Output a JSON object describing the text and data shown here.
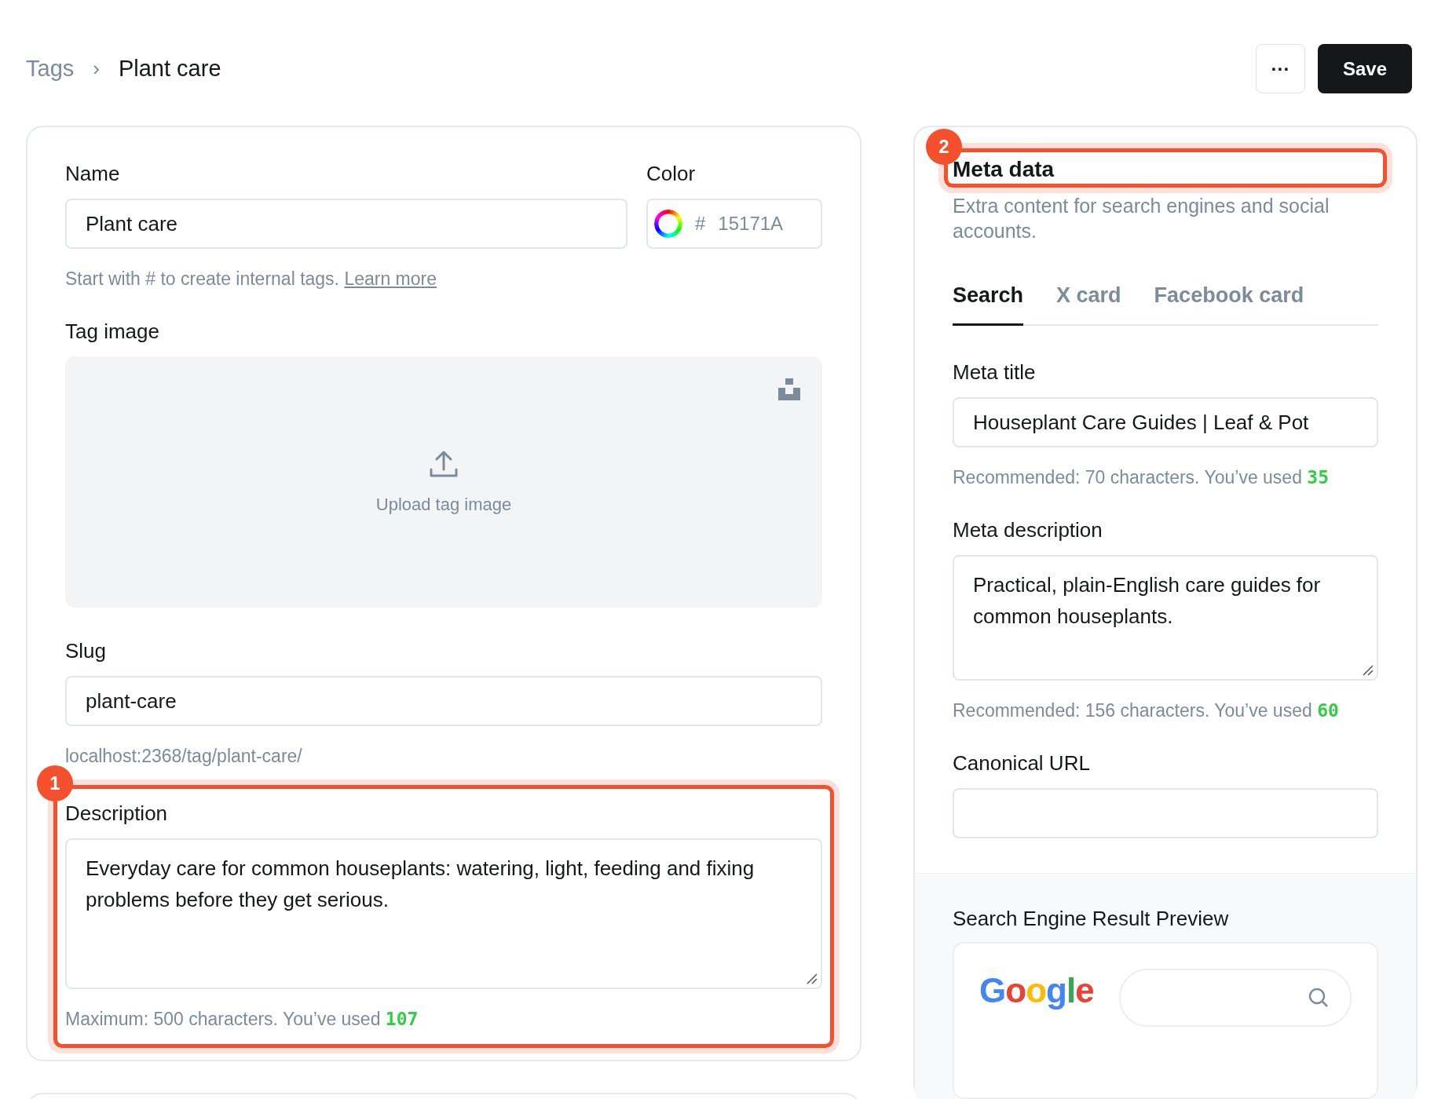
{
  "breadcrumb": {
    "parent": "Tags",
    "separator": "›",
    "current": "Plant care"
  },
  "header_actions": {
    "more": "···",
    "save": "Save"
  },
  "tag_form": {
    "name": {
      "label": "Name",
      "value": "Plant care"
    },
    "color": {
      "label": "Color",
      "hash": "#",
      "value": "15171A"
    },
    "name_hint": {
      "text": "Start with # to create internal tags.",
      "link": "Learn more"
    },
    "image": {
      "label": "Tag image",
      "upload": "Upload tag image"
    },
    "slug": {
      "label": "Slug",
      "value": "plant-care",
      "url": "localhost:2368/tag/plant-care/"
    },
    "description": {
      "callout": "1",
      "label": "Description",
      "value": "Everyday care for common houseplants: watering, light, feeding and fixing problems before they get serious.",
      "hint": "Maximum: 500 characters. You’ve used **107**"
    }
  },
  "meta_data": {
    "callout": "2",
    "title": "Meta data",
    "subtitle": "Extra content for search engines and social accounts.",
    "tabs": [
      {
        "label": "Search",
        "selected": true
      },
      {
        "label": "X card",
        "selected": false
      },
      {
        "label": "Facebook card",
        "selected": false
      }
    ],
    "meta_title": {
      "label": "Meta title",
      "value": "Houseplant Care Guides | Leaf & Pot",
      "hint": "Recommended: 70 characters. You’ve used **35**"
    },
    "meta_description": {
      "label": "Meta description",
      "value": "Practical, plain-English care guides for common houseplants.",
      "hint": "Recommended: 156 characters. You’ve used **60**"
    },
    "canonical": {
      "label": "Canonical URL"
    },
    "preview": {
      "label": "Search Engine Result Preview",
      "logo": "Google"
    }
  }
}
